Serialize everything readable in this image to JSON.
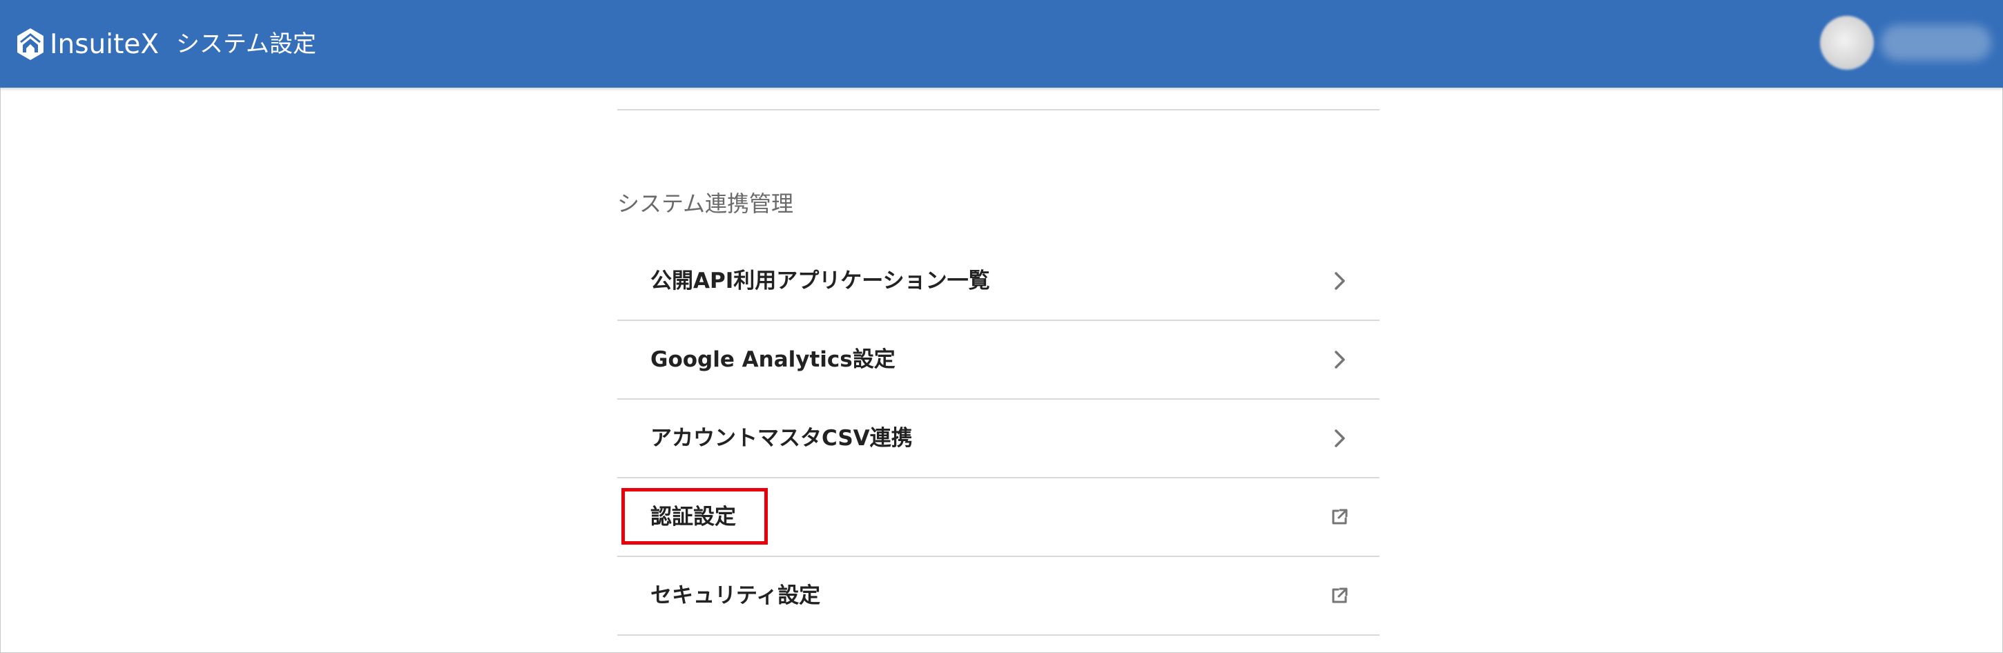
{
  "header": {
    "logo_text": "InsuiteX",
    "title": "システム設定",
    "brand_color": "#356fba",
    "icons": {
      "logo": "insuite-logo-icon",
      "avatar": "user-avatar"
    }
  },
  "section": {
    "title": "システム連携管理"
  },
  "menu": {
    "items": [
      {
        "label": "公開API利用アプリケーション一覧",
        "icon": "chevron-right-icon"
      },
      {
        "label": "Google Analytics設定",
        "icon": "chevron-right-icon"
      },
      {
        "label": "アカウントマスタCSV連携",
        "icon": "chevron-right-icon"
      },
      {
        "label": "認証設定",
        "icon": "external-link-icon",
        "highlighted": true
      },
      {
        "label": "セキュリティ設定",
        "icon": "external-link-icon"
      }
    ]
  },
  "colors": {
    "highlight": "#e8000b",
    "divider": "#d9d9d9",
    "icon": "#757575"
  }
}
